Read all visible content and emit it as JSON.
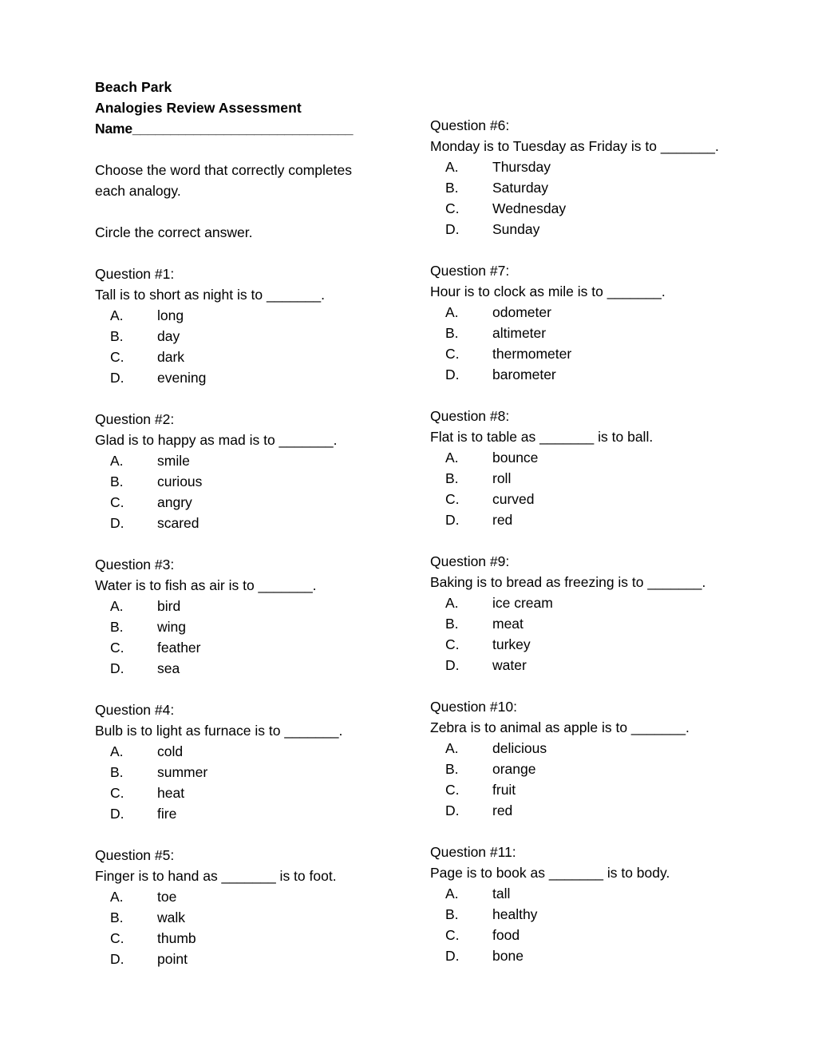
{
  "header": {
    "school": "Beach Park",
    "title": "Analogies Review Assessment",
    "name_label": "Name",
    "name_blank": "_____________________________"
  },
  "instructions": {
    "line1": "Choose the word that correctly completes each analogy.",
    "line2": "Circle the correct answer."
  },
  "blank": "_______",
  "columns": {
    "left": [
      {
        "label": "Question #1:",
        "prompt": "Tall is to short as night is to _______.",
        "options": [
          {
            "letter": "A.",
            "text": "long"
          },
          {
            "letter": "B.",
            "text": "day"
          },
          {
            "letter": "C.",
            "text": "dark"
          },
          {
            "letter": "D.",
            "text": "evening"
          }
        ]
      },
      {
        "label": "Question #2:",
        "prompt": "Glad is to happy as mad is to _______.",
        "options": [
          {
            "letter": "A.",
            "text": "smile"
          },
          {
            "letter": "B.",
            "text": "curious"
          },
          {
            "letter": "C.",
            "text": "angry"
          },
          {
            "letter": "D.",
            "text": "scared"
          }
        ]
      },
      {
        "label": "Question #3:",
        "prompt": "Water is to fish as air is to _______.",
        "options": [
          {
            "letter": "A.",
            "text": "bird"
          },
          {
            "letter": "B.",
            "text": "wing"
          },
          {
            "letter": "C.",
            "text": "feather"
          },
          {
            "letter": "D.",
            "text": "sea"
          }
        ]
      },
      {
        "label": "Question #4:",
        "prompt": "Bulb is to light as furnace is to _______.",
        "options": [
          {
            "letter": "A.",
            "text": "cold"
          },
          {
            "letter": "B.",
            "text": "summer"
          },
          {
            "letter": "C.",
            "text": "heat"
          },
          {
            "letter": "D.",
            "text": "fire"
          }
        ]
      },
      {
        "label": "Question #5:",
        "prompt": "Finger is to hand as _______ is to foot.",
        "options": [
          {
            "letter": "A.",
            "text": "toe"
          },
          {
            "letter": "B.",
            "text": "walk"
          },
          {
            "letter": "C.",
            "text": "thumb"
          },
          {
            "letter": "D.",
            "text": "point"
          }
        ]
      }
    ],
    "right": [
      {
        "label": "Question #6:",
        "prompt": "Monday is to Tuesday as Friday is to _______.",
        "options": [
          {
            "letter": "A.",
            "text": "Thursday"
          },
          {
            "letter": "B.",
            "text": "Saturday"
          },
          {
            "letter": "C.",
            "text": "Wednesday"
          },
          {
            "letter": "D.",
            "text": "Sunday"
          }
        ]
      },
      {
        "label": "Question #7:",
        "prompt": "Hour is to clock as mile is to _______.",
        "options": [
          {
            "letter": "A.",
            "text": "odometer"
          },
          {
            "letter": "B.",
            "text": "altimeter"
          },
          {
            "letter": "C.",
            "text": "thermometer"
          },
          {
            "letter": "D.",
            "text": "barometer"
          }
        ]
      },
      {
        "label": "Question #8:",
        "prompt": "Flat is to table as _______ is to ball.",
        "options": [
          {
            "letter": "A.",
            "text": "bounce"
          },
          {
            "letter": "B.",
            "text": "roll"
          },
          {
            "letter": "C.",
            "text": "curved"
          },
          {
            "letter": "D.",
            "text": "red"
          }
        ]
      },
      {
        "label": "Question #9:",
        "prompt": "Baking is to bread as freezing is to _______.",
        "options": [
          {
            "letter": "A.",
            "text": "ice cream"
          },
          {
            "letter": "B.",
            "text": "meat"
          },
          {
            "letter": "C.",
            "text": "turkey"
          },
          {
            "letter": "D.",
            "text": "water"
          }
        ]
      },
      {
        "label": "Question #10:",
        "prompt": "Zebra is to animal as apple is to _______.",
        "options": [
          {
            "letter": "A.",
            "text": "delicious"
          },
          {
            "letter": "B.",
            "text": "orange"
          },
          {
            "letter": "C.",
            "text": "fruit"
          },
          {
            "letter": "D.",
            "text": "red"
          }
        ]
      },
      {
        "label": "Question #11:",
        "prompt": "Page is to book as _______ is to body.",
        "options": [
          {
            "letter": "A.",
            "text": "tall"
          },
          {
            "letter": "B.",
            "text": "healthy"
          },
          {
            "letter": "C.",
            "text": "food"
          },
          {
            "letter": "D.",
            "text": "bone"
          }
        ]
      }
    ]
  }
}
